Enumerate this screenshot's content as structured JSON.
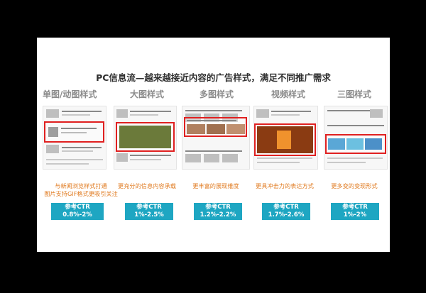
{
  "slide": {
    "title": "PC信息流—越来越接近内容的广告样式，满足不同推广需求",
    "columns": [
      {
        "title": "单图/动图样式",
        "desc": [
          "与新闻浏览样式打通",
          "图片支持GIF格式更吸引关注"
        ],
        "ctr_label": "参考CTR",
        "ctr_value": "0.8%-2%"
      },
      {
        "title": "大图样式",
        "desc": [
          "更充分的信息内容承载"
        ],
        "ctr_label": "参考CTR",
        "ctr_value": "1%-2.5%"
      },
      {
        "title": "多图样式",
        "desc": [
          "更丰富的展现维度"
        ],
        "ctr_label": "参考CTR",
        "ctr_value": "1.2%-2.2%"
      },
      {
        "title": "视频样式",
        "desc": [
          "更具冲击力的表达方式"
        ],
        "ctr_label": "参考CTR",
        "ctr_value": "1.7%-2.6%"
      },
      {
        "title": "三图样式",
        "desc": [
          "更多变的变现形式"
        ],
        "ctr_label": "参考CTR",
        "ctr_value": "1%-2%"
      }
    ]
  },
  "colors": {
    "highlight": "#e02020",
    "ctr_bg": "#1ea6c2",
    "desc_text": "#e07a1f"
  }
}
